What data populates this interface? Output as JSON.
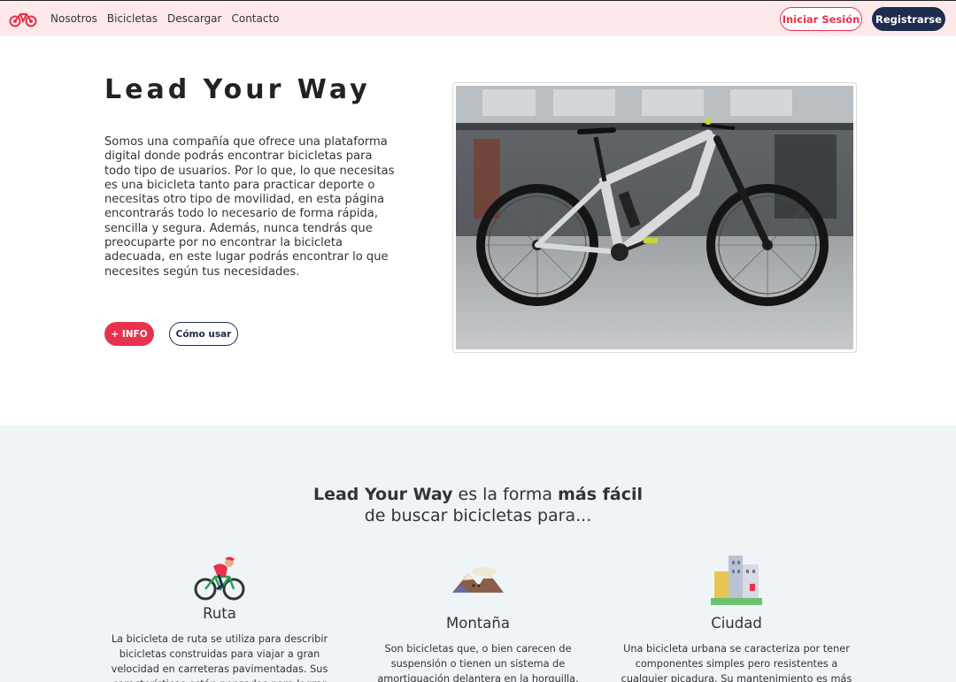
{
  "nav": {
    "links": [
      "Nosotros",
      "Bicicletas",
      "Descargar",
      "Contacto"
    ],
    "login_label": "Iniciar Sesión",
    "register_label": "Registrarse"
  },
  "hero": {
    "title": "Lead Your Way",
    "description": "Somos una compañía que ofrece una plataforma digital donde podrás encontrar bicicletas para todo tipo de usuarios. Por lo que, lo que necesitas es una bicicleta tanto para practicar deporte o necesitas otro tipo de movilidad, en esta página encontrarás todo lo necesario de forma rápida, sencilla y segura. Además, nunca tendrás que preocuparte por no encontrar la bicicleta adecuada, en este lugar podrás encontrar lo que necesites según tus necesidades.",
    "info_label": "+ INFO",
    "howto_label": "Cómo usar"
  },
  "features": {
    "title_bold1": "Lead Your Way",
    "title_mid": " es la forma ",
    "title_bold2": "más fácil",
    "title_line2": "de buscar bicicletas para...",
    "cards": [
      {
        "title": "Ruta",
        "text": "La bicicleta de ruta se utiliza para describir bicicletas construidas para viajar a gran velocidad en carreteras pavimentadas. Sus características están pensadas para lograr trasladarse rápido"
      },
      {
        "title": "Montaña",
        "text": "Son bicicletas que, o bien carecen de suspensión o tienen un sistema de amortiguación delantera en la horquilla. Normalmente el recorrido de esta"
      },
      {
        "title": "Ciudad",
        "text": "Una bicicleta urbana se caracteriza por tener componentes simples pero resistentes a cualquier picadura. Su mantenimiento es más sencillo y por"
      }
    ]
  },
  "colors": {
    "accent": "#e8324d",
    "navy": "#1e2c4f",
    "nav_bg": "#fde9ea",
    "section_bg": "#eff5f7"
  }
}
